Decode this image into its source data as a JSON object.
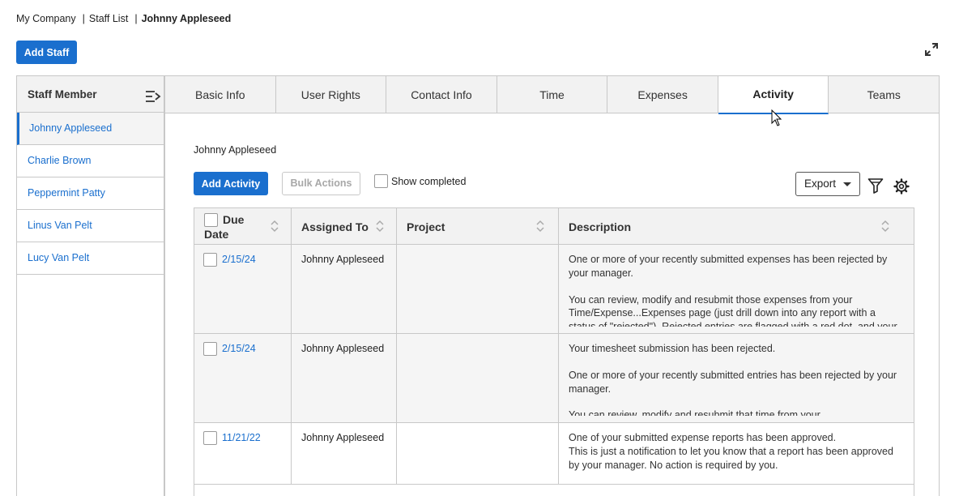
{
  "breadcrumb": {
    "company": "My Company",
    "list": "Staff List",
    "current": "Johnny Appleseed",
    "separator": "|"
  },
  "toolbar": {
    "add_staff": "Add Staff"
  },
  "sidebar": {
    "title": "Staff Member",
    "items": [
      {
        "label": "Johnny Appleseed",
        "active": true
      },
      {
        "label": "Charlie Brown"
      },
      {
        "label": "Peppermint Patty"
      },
      {
        "label": "Linus Van Pelt"
      },
      {
        "label": "Lucy Van Pelt"
      }
    ]
  },
  "tabs": [
    {
      "label": "Basic Info"
    },
    {
      "label": "User Rights"
    },
    {
      "label": "Contact Info"
    },
    {
      "label": "Time"
    },
    {
      "label": "Expenses"
    },
    {
      "label": "Activity",
      "active": true
    },
    {
      "label": "Teams"
    }
  ],
  "activity": {
    "subject": "Johnny Appleseed",
    "add_label": "Add Activity",
    "bulk_label": "Bulk Actions",
    "show_completed_label": "Show completed",
    "export_label": "Export"
  },
  "grid": {
    "columns": {
      "due": "Due Date",
      "due_line1": "Due",
      "due_line2": "Date",
      "assigned": "Assigned To",
      "project": "Project",
      "description": "Description"
    },
    "rows": [
      {
        "due": "2/15/24",
        "assigned": "Johnny Appleseed",
        "project": "",
        "desc_p1": "One or more of your recently submitted expenses has been rejected by your manager.",
        "desc_p2": "You can review, modify and resubmit those expenses from your Time/Expense...Expenses page (just drill down into any report with a status of \"rejected\"). Rejected entries are flagged with a red dot, and your"
      },
      {
        "due": "2/15/24",
        "assigned": "Johnny Appleseed",
        "project": "",
        "desc_p1": "Your timesheet submission has been rejected.",
        "desc_p2": "One or more of your recently submitted entries has been rejected by your manager.",
        "desc_p3": "You can review, modify and resubmit that time from your"
      },
      {
        "due": "11/21/22",
        "assigned": "Johnny Appleseed",
        "project": "",
        "desc_p1": "One of your submitted expense reports has been approved.",
        "desc_p2": "This is just a notification to let you know that a report has been approved by your manager. No action is required by you."
      }
    ]
  },
  "colors": {
    "accent": "#1a6fce",
    "header_bg": "#f2f2f2",
    "border": "#c8c8c8"
  }
}
